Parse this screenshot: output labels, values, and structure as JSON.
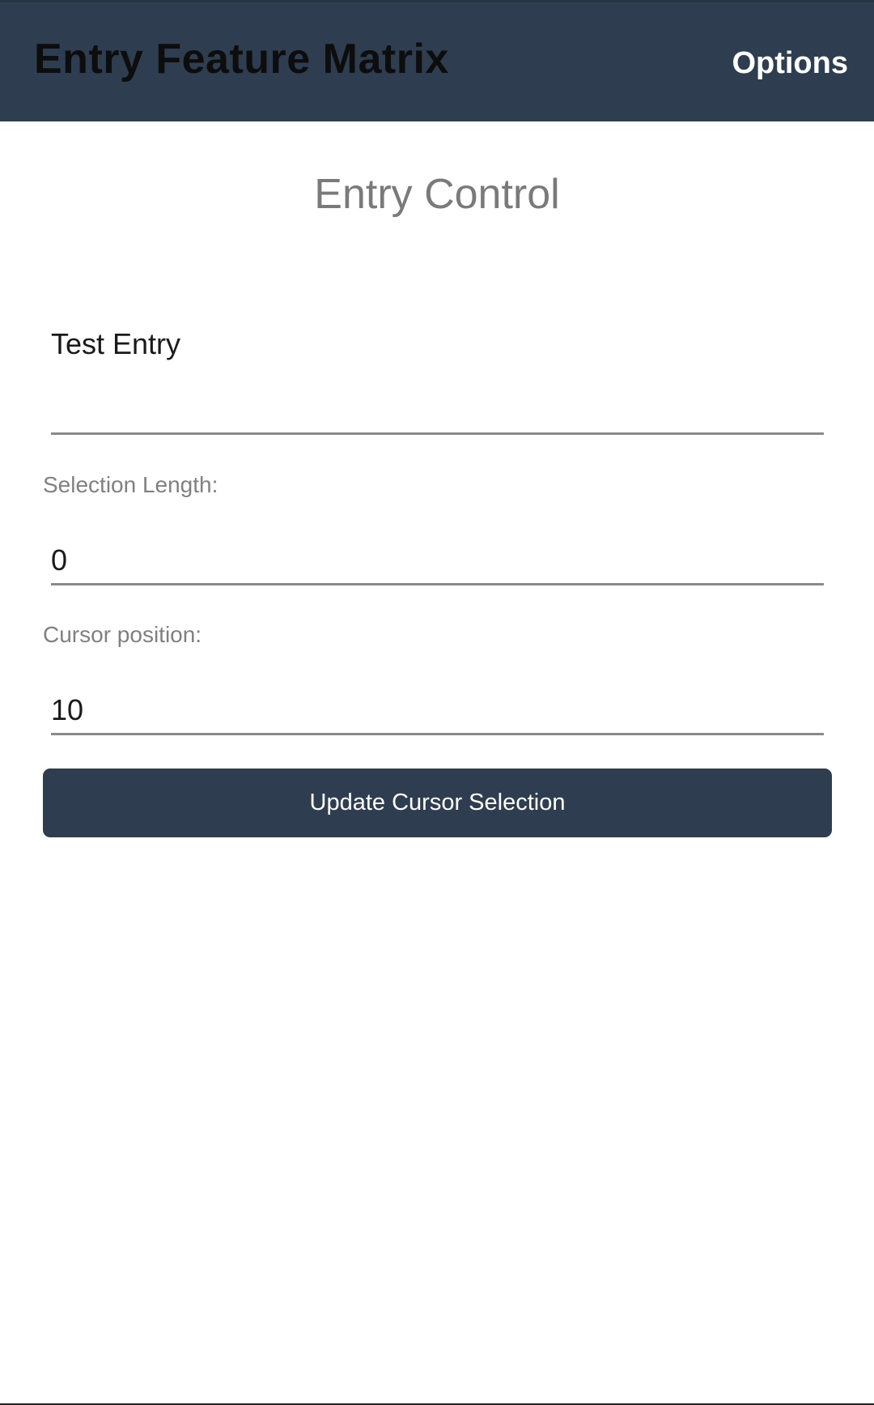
{
  "app_bar": {
    "title": "Entry Feature Matrix",
    "options_label": "Options",
    "background": "#2e3e50"
  },
  "main": {
    "heading": "Entry Control",
    "test_entry": {
      "value": "Test Entry"
    },
    "selection_length": {
      "label": "Selection Length:",
      "value": "0"
    },
    "cursor_position": {
      "label": "Cursor position:",
      "value": "10"
    },
    "update_button_label": "Update Cursor Selection"
  }
}
